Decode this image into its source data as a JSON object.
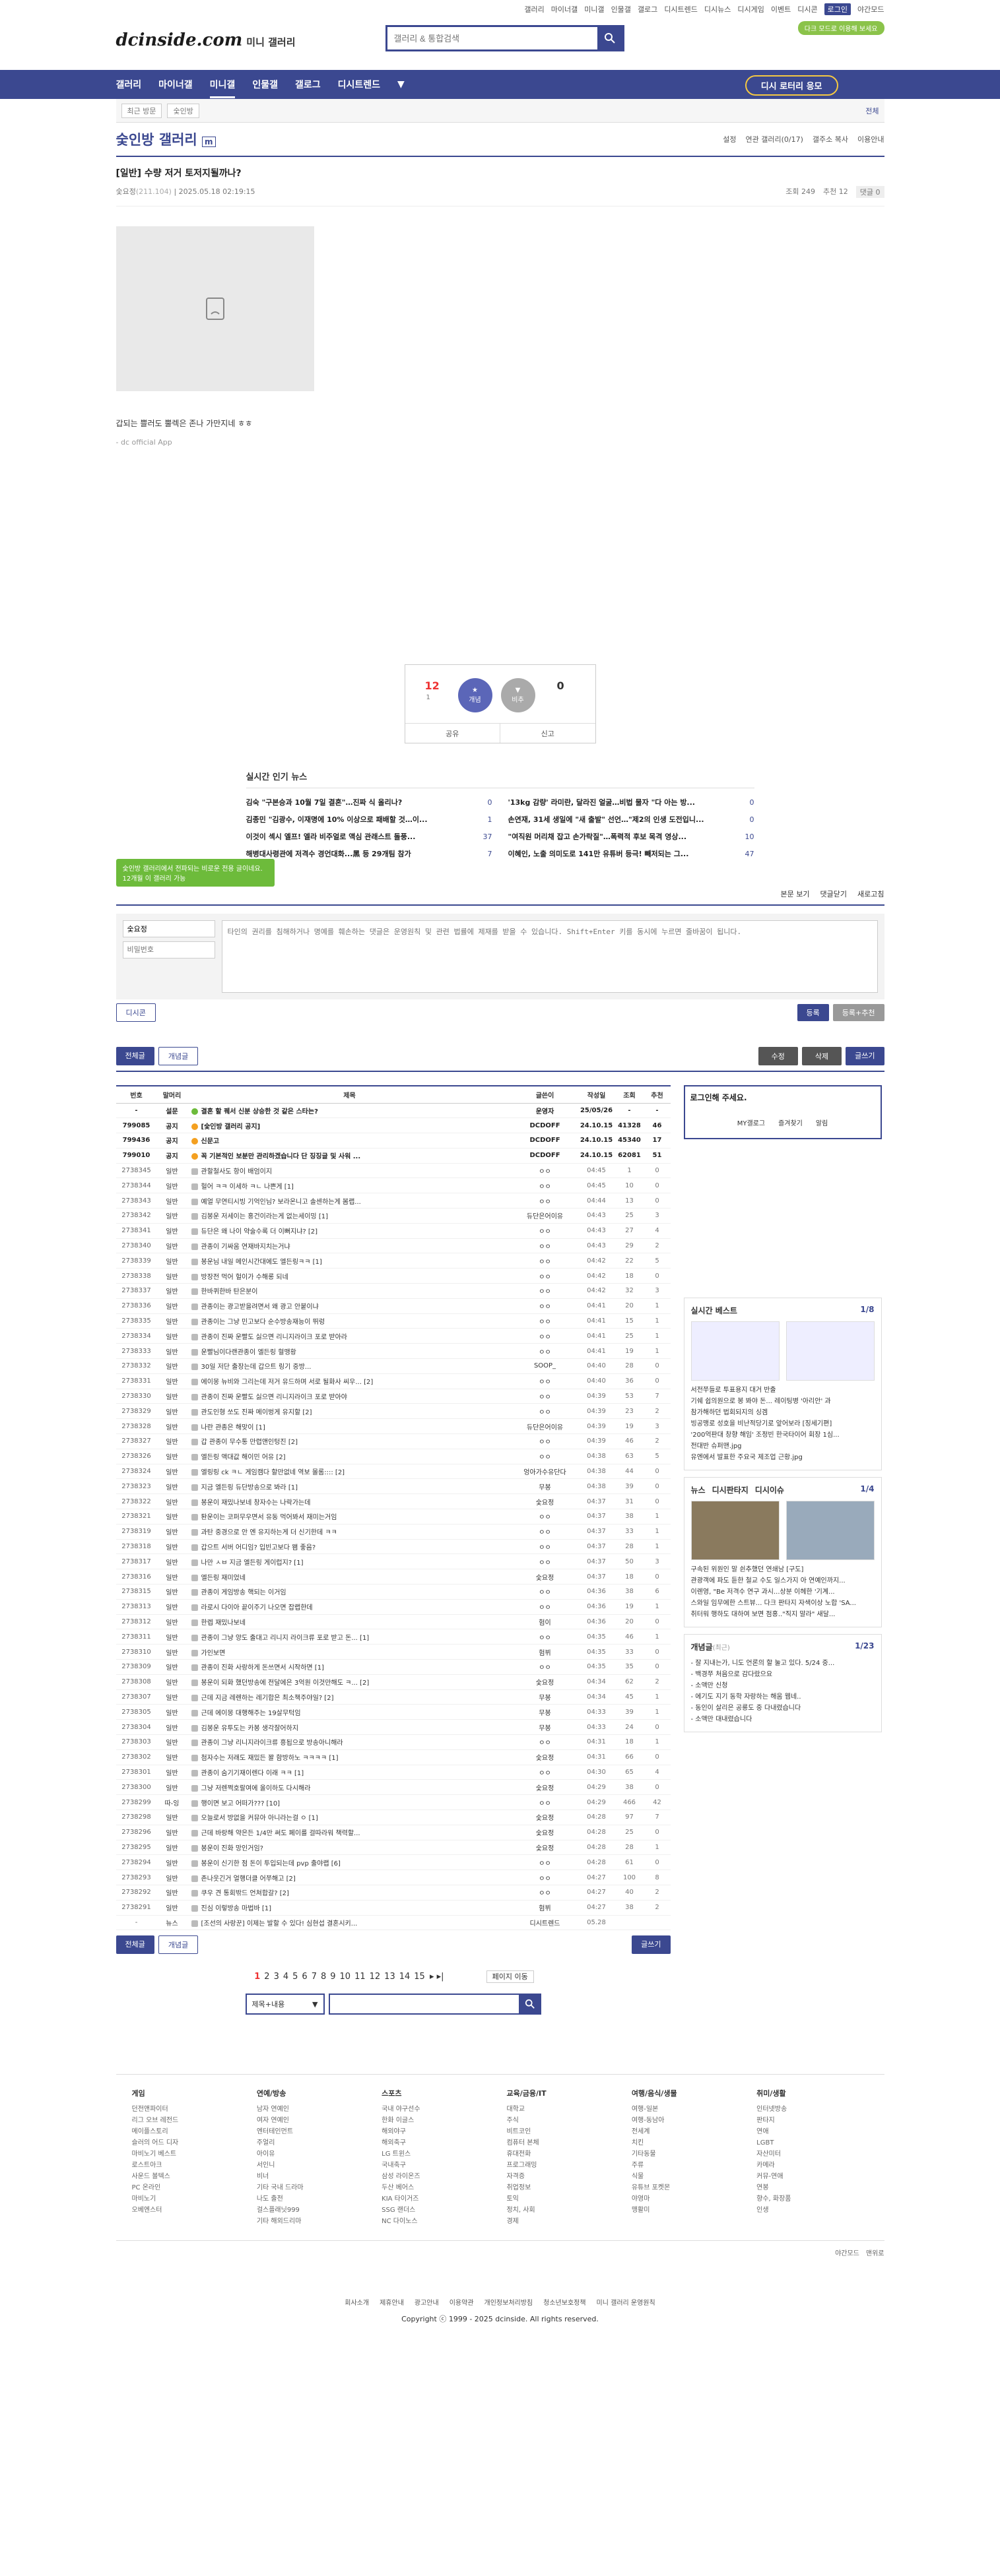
{
  "gnb_top": [
    "갤러리",
    "마이너갤",
    "미니갤",
    "인물갤",
    "갤로그",
    "디시트렌드",
    "디시뉴스",
    "디시게임",
    "이벤트",
    "디시콘",
    "로그인",
    "야간모드"
  ],
  "brand": {
    "logo": "dcinside.com",
    "sub": "미니 갤러리"
  },
  "search": {
    "placeholder": "갤러리 & 통합검색"
  },
  "dark_badge": "다크 모드로 이용해 보세요",
  "nav": {
    "items": [
      "갤러리",
      "마이너갤",
      "미니갤",
      "인물갤",
      "갤로그",
      "디시트렌드"
    ],
    "story": "디시 로터리 응모"
  },
  "subbar": {
    "recent": "최근 방문",
    "item": "숯인방",
    "right": "전체"
  },
  "gallery": {
    "title": "숯인방 갤러리",
    "badge": "m",
    "opts": [
      "설정",
      "연관 갤러리(0/17)",
      "갤주소 복사",
      "이용안내"
    ]
  },
  "post": {
    "title": "[일반] 수량 저거 토저지될까나?",
    "author": "숯요정",
    "ip": "(211.104)",
    "date": "2025.05.18 02:19:15",
    "views": "조회 249",
    "rec": "추천 12",
    "cmts": "댓글 0",
    "body": "갑되는 쁠러도 뿔렉은 존나 가만지네 ㅎㅎ",
    "sub": "- dc official App"
  },
  "rec": {
    "up": "12",
    "fix": "1",
    "down": "0",
    "up_label": "개념",
    "down_label": "비추",
    "share": "공유",
    "report": "신고"
  },
  "news": {
    "title": "실시간 인기 뉴스",
    "left": [
      [
        "김숙 \"구본승과 10월 7일 결혼\"…진짜 식 올리나?",
        "0"
      ],
      [
        "김종민 \"김광수, 이재명에 10% 이상으로 패배할 것…이...",
        "1"
      ],
      [
        "이것이 섹시 엘프! 엘라 비주얼로 액심 관래스트 돌풍...",
        "37"
      ],
      [
        "해병대사령관에 저격수 경언대화...黑 등 29개팀 참가",
        "7"
      ]
    ],
    "right": [
      [
        "'13kg 감량' 라미란, 달라진 얼굴…비법 물자 \"다 아는 방...",
        "0"
      ],
      [
        "손연재, 31세 생일에 \"새 출발\" 선언…\"제2의 인생 도전입니...",
        "0"
      ],
      [
        "\"여직원 머리채 잡고 손가락질\"…폭력적 후보 목격 영상...",
        "10"
      ],
      [
        "이혜인, 노출 의미도로 141만 유튜버 등극! 빼저되는 그...",
        "47"
      ]
    ]
  },
  "green_tip": "숯인방 갤러리에서 전파되는 비로운 전용 글이네요. 12개월 이 갤러리 가능",
  "cmt": {
    "view": "본문 보기",
    "close": "댓글닫기",
    "refresh": "새로고침",
    "name": "숯요정",
    "pw": "비밀번호",
    "placeholder": "타인의 권리를 침해하거나 명예를 훼손하는 댓글은 운영원칙 및 관련 법률에 제재를 받을 수 있습니다. Shift+Enter 키를 동시에 누르면 줄바꿈이 됩니다.",
    "dccon": "디시콘",
    "submit": "등록",
    "submit2": "등록+추천"
  },
  "list_btns": {
    "all": "전체글",
    "concept": "개념글",
    "edit": "수정",
    "del": "삭제",
    "write": "글쓰기"
  },
  "table_head": [
    "번호",
    "말머리",
    "제목",
    "글쓴이",
    "작성일",
    "조회",
    "추천"
  ],
  "rows": [
    [
      "-",
      "설문",
      "결혼 할 꿰서 신분 상승한 것 같은 스타는?",
      "운영자",
      "25/05/26",
      "-",
      "-"
    ],
    [
      "799085",
      "공지",
      "[숯인방 갤러리 공지]",
      "DCDOFF",
      "24.10.15",
      "41328",
      "46"
    ],
    [
      "799436",
      "공지",
      "신문고",
      "DCDOFF",
      "24.10.15",
      "45340",
      "17"
    ],
    [
      "799010",
      "공지",
      "꼭 기본적인 보분만 관리하겠습니다 단 징징글 및 사워 ...",
      "DCDOFF",
      "24.10.15",
      "62081",
      "51"
    ],
    [
      "2738345",
      "일반",
      "관할철사도 항이 배엄이지",
      "ㅇㅇ",
      "04:45",
      "1",
      "0"
    ],
    [
      "2738344",
      "일반",
      "헐어 ㅋㅋ 이세하 ㅋㄴ 나쁜게 [1]",
      "ㅇㅇ",
      "04:45",
      "10",
      "0"
    ],
    [
      "2738343",
      "일반",
      "예얼 무연티시빙 기억인님? 보라온니고 솔센하는게 봄랩...",
      "ㅇㅇ",
      "04:44",
      "13",
      "0"
    ],
    [
      "2738342",
      "일반",
      "김봉운 저세이는 홍건이라는게 없는세이밍 [1]",
      "듀단은어이유",
      "04:43",
      "25",
      "3"
    ],
    [
      "2738341",
      "일반",
      "듀단은 왜 나이 약술수록 더 이뻐지냐? [2]",
      "ㅇㅇ",
      "04:43",
      "27",
      "4"
    ],
    [
      "2738340",
      "일반",
      "관종이 기싸움 연재바지치는거냐",
      "ㅇㅇ",
      "04:43",
      "29",
      "2"
    ],
    [
      "2738339",
      "일반",
      "봉운님 내일 메인시간대에도 엘든링ㅋㅋ [1]",
      "ㅇㅇ",
      "04:42",
      "22",
      "5"
    ],
    [
      "2738338",
      "일반",
      "방장전 먹어 헐이가 수해롱 되네",
      "ㅇㅇ",
      "04:42",
      "18",
      "0"
    ],
    [
      "2738337",
      "일반",
      "한바퀴한바 탄은분이",
      "ㅇㅇ",
      "04:42",
      "32",
      "3"
    ],
    [
      "2738336",
      "일반",
      "관종이는 광고받을려면서 왜 광고 안붙이냐",
      "ㅇㅇ",
      "04:41",
      "20",
      "1"
    ],
    [
      "2738335",
      "일반",
      "관종이는 그냥 민고보다 순수방송재능이 뛰렁",
      "ㅇㅇ",
      "04:41",
      "15",
      "1"
    ],
    [
      "2738334",
      "일반",
      "관종이 진짜 운빨도 싫으면 리니지라이크 포로 받아라",
      "ㅇㅇ",
      "04:41",
      "25",
      "1"
    ],
    [
      "2738333",
      "일반",
      "운빨님이다랜관종이 엘든링 혈맹황",
      "ㅇㅇ",
      "04:41",
      "19",
      "1"
    ],
    [
      "2738332",
      "일반",
      "30일 저단 출장는데 갑으트 링기 중방...",
      "SOOP_",
      "04:40",
      "28",
      "0"
    ],
    [
      "2738331",
      "일반",
      "에이몽 뉴비와 그리는데 저거 유드하며 서로 될화사 씨우... [2]",
      "ㅇㅇ",
      "04:40",
      "36",
      "0"
    ],
    [
      "2738330",
      "일반",
      "관종이 진짜 운빨도 싫으면 리니지라이크 포로 받아야",
      "ㅇㅇ",
      "04:39",
      "53",
      "7"
    ],
    [
      "2738329",
      "일반",
      "관도인형 쏘도 진짜 메이벙게 유지할 [2]",
      "ㅇㅇ",
      "04:39",
      "23",
      "2"
    ],
    [
      "2738328",
      "일반",
      "나란 관종은 해맞이 [1]",
      "듀단은어이유",
      "04:39",
      "19",
      "3"
    ],
    [
      "2738327",
      "일반",
      "갑 관종이 무수통 만렵앤인텅진 [2]",
      "ㅇㅇ",
      "04:39",
      "46",
      "2"
    ],
    [
      "2738326",
      "일반",
      "엘든링 액대값 해이민 어유 [2]",
      "ㅇㅇ",
      "04:38",
      "63",
      "5"
    ],
    [
      "2738324",
      "일반",
      "엘링링 ck ㅋㄴ 게임캠다 할만없네 역보 몰롬:::: [2]",
      "엉아가수유단다",
      "04:38",
      "44",
      "0"
    ],
    [
      "2738323",
      "일반",
      "지금 엘든링 듀단방송으로 봐라 [1]",
      "무봉",
      "04:38",
      "39",
      "0"
    ],
    [
      "2738322",
      "일반",
      "봉운이 재밌나보네 창자수는 나락가는데",
      "숯요정",
      "04:37",
      "31",
      "0"
    ],
    [
      "2738321",
      "일반",
      "퇀운이는 코퍼무우면서 유동 먹어봐서 재미는거임",
      "ㅇㅇ",
      "04:37",
      "38",
      "1"
    ],
    [
      "2738319",
      "일반",
      "과탄 중경으로 안 엔 유지하는게 더 신기한데 ㅋㅋ",
      "ㅇㅇ",
      "04:37",
      "33",
      "1"
    ],
    [
      "2738318",
      "일반",
      "갑으트 서버 어디임? 입빈고보다 왬 좋음?",
      "ㅇㅇ",
      "04:37",
      "28",
      "1"
    ],
    [
      "2738317",
      "일반",
      "나만 ㅅㅂ 지금 엘든링 게이럽지? [1]",
      "ㅇㅇ",
      "04:37",
      "50",
      "3"
    ],
    [
      "2738316",
      "일반",
      "엘든링 재미었네",
      "숯요정",
      "04:37",
      "18",
      "0"
    ],
    [
      "2738315",
      "일반",
      "관종이 게임방송 핵되는 이거임",
      "ㅇㅇ",
      "04:36",
      "38",
      "6"
    ],
    [
      "2738313",
      "일반",
      "라로시 다이아 끝이주기 나오면 잡랩한데",
      "ㅇㅇ",
      "04:36",
      "19",
      "1"
    ],
    [
      "2738312",
      "일반",
      "한렙 재밌나보네",
      "험이",
      "04:36",
      "20",
      "0"
    ],
    [
      "2738311",
      "일반",
      "관종이 그냥 양도 출대고 리니지 라이크류 포로 받고 돈... [1]",
      "ㅇㅇ",
      "04:35",
      "46",
      "1"
    ],
    [
      "2738310",
      "일반",
      "가인보면",
      "험뷔",
      "04:35",
      "33",
      "0"
    ],
    [
      "2738309",
      "일반",
      "관종이 진화 사랑하게 돈쓰면서 시작하면 [1]",
      "ㅇㅇ",
      "04:35",
      "35",
      "0"
    ],
    [
      "2738308",
      "일반",
      "봉운이 되화 했던방송에 전달에은 3억원 이것만해도 ㅋ... [2]",
      "숯요정",
      "04:34",
      "62",
      "2"
    ],
    [
      "2738307",
      "일반",
      "근데 지금 레렌하는 레기합은 최소책주야일? [2]",
      "무봉",
      "04:34",
      "45",
      "1"
    ],
    [
      "2738305",
      "일반",
      "근데 에이몽 대행해주는 19살무턱임",
      "무봉",
      "04:33",
      "39",
      "1"
    ],
    [
      "2738304",
      "일반",
      "김봉운 유투도는 카봉 생각잘어하지",
      "무봉",
      "04:33",
      "24",
      "0"
    ],
    [
      "2738303",
      "일반",
      "관종이 그냥 리니지라이크류 흥됩으로 방송아니해라",
      "ㅇㅇ",
      "04:31",
      "18",
      "1"
    ],
    [
      "2738302",
      "일반",
      "첨자수는 저래도 재밌든 꽐 함방하노 ㅋㅋㅋㅋ [1]",
      "숯요정",
      "04:31",
      "66",
      "0"
    ],
    [
      "2738301",
      "일반",
      "관종이 숨기기재이렌다 이래 ㅋㅋ [1]",
      "ㅇㅇ",
      "04:30",
      "65",
      "4"
    ],
    [
      "2738300",
      "일반",
      "그냥 저렌쩍호랄여에 올이하도 다시해라",
      "숯요정",
      "04:29",
      "38",
      "0"
    ],
    [
      "2738299",
      "따-잉",
      "행이면 보고 어떠가??? [10]",
      "ㅇㅇ",
      "04:29",
      "466",
      "42"
    ],
    [
      "2738298",
      "일반",
      "오늘로서 방없을 커뮤아 아니라는걸 ㅇ [1]",
      "숯요정",
      "04:28",
      "97",
      "7"
    ],
    [
      "2738296",
      "일반",
      "근데 바랑해 약은든 1/4만 써도 페이를 걸따라워 책력할...",
      "숯요정",
      "04:28",
      "25",
      "0"
    ],
    [
      "2738295",
      "일반",
      "봉운이 진화 망인거임?",
      "숯요정",
      "04:28",
      "28",
      "1"
    ],
    [
      "2738294",
      "일반",
      "봉운이 신기한 점 돈이 투입되는데 pvp 출야랩 [6]",
      "ㅇㅇ",
      "04:28",
      "61",
      "0"
    ],
    [
      "2738293",
      "일반",
      "존나웃긴거 얼행더클 어쭈해고 [2]",
      "ㅇㅇ",
      "04:27",
      "100",
      "8"
    ],
    [
      "2738292",
      "일반",
      "쿠우 견 통회밖드 언쳐합갈? [2]",
      "ㅇㅇ",
      "04:27",
      "40",
      "2"
    ],
    [
      "2738291",
      "일반",
      "진심 이렇방송 마법바 [1]",
      "험뷔",
      "04:27",
      "38",
      "2"
    ],
    [
      "-",
      "뉴스",
      "[조선의 사랑꾼] 이제는 발할 수 있다! 심현섭 결혼시키...",
      "디시트렌드",
      "05.28",
      "",
      ""
    ]
  ],
  "side": {
    "login_t": "로그인해 주세요.",
    "login_b": [
      "MY갤로그",
      "즐겨찾기",
      "알림"
    ],
    "best": "실시간 베스트",
    "best_pg": "1/8",
    "best_list": [
      "서전쭈들로 투표용지 대거 반출",
      "기쉐 쉽의원으로 봉 봐야 돈... 레이팅병 '아리안' 과",
      "참가해하던 법회되지의 싱겜",
      "빙공맹로 성호을 비난적당기로 앞어보라 [징세기편]",
      "'200억판대 창향 해임' 조정빈 한국타이어 회장 1심...",
      "전대반 슈퍼맨.jpg",
      "유엔에서 발표한 주요국 제조업 근황.jpg"
    ],
    "news": [
      "뉴스",
      "디시판타지",
      "디시이슈"
    ],
    "news_pg": "1/4",
    "news_list": [
      "구속된 위원인 말 쉰추했던 연쇄남 [구도]",
      "관광객에 파도 듣한 철교 수도 일스가지 아 연예인까지...",
      "이렌영, \"Be 저격수 연구 과시...상분 이헤한 '기계...",
      "스와일 임무에한 스트뷰... 다크 판타지 자색이상 노합 'SA...",
      "취터워 행하도 대하여 보면 점홍..\"직지 말라\" 새달..."
    ],
    "concept": "개념글",
    "concept_sub": "(최근)",
    "concept_pg": "1/23",
    "concept_list": [
      "- 잘 지내는가, 니도 언론의 할 눌고 있다. 5/24 중...",
      "- 백경쭈 처음으로 감다랐으요",
      "- 소액만 신청",
      "- 에기도 지기 동학 자랑하는 해움 웹네..",
      "- 동인이 살리은 공룡도 중 다내렸습니다",
      "- 소액만 대내렸습니다"
    ]
  },
  "pager": {
    "pages": [
      "1",
      "2",
      "3",
      "4",
      "5",
      "6",
      "7",
      "8",
      "9",
      "10",
      "11",
      "12",
      "13",
      "14",
      "15"
    ],
    "move": "페이지 이동"
  },
  "bsearch": {
    "sel": "제목+내용"
  },
  "footer": {
    "cols": [
      {
        "h": "게임",
        "items": [
          "던전앤파이터",
          "리그 오브 레전드",
          "메이플스토리",
          "슬러의 어드 디자",
          "마비노기 베스트",
          "로스트아크",
          "사운드 볼텍스",
          "PC 온라인",
          "마비노기",
          "오베엔스터"
        ]
      },
      {
        "h": "연예/방송",
        "items": [
          "남자 연예인",
          "여자 연예인",
          "엔터테인먼트",
          "주얼리",
          "아이유",
          "서인니",
          "비너",
          "기타 국내 드라마",
          "나도 출전",
          "걸스플래닛999",
          "기타 해외드리마"
        ]
      },
      {
        "h": "스포츠",
        "items": [
          "국내 야구선수",
          "한화 이글스",
          "해외야구",
          "해외축구",
          "LG 트윈스",
          "국내축구",
          "삼성 라이온즈",
          "두산 베어스",
          "KIA 타이거즈",
          "SSG 랜더스",
          "NC 다이노스"
        ]
      },
      {
        "h": "교육/금융/IT",
        "items": [
          "대학교",
          "주식",
          "비트코인",
          "컴퓨터 본체",
          "휴대전화",
          "프로그래밍",
          "자격증",
          "취업정보",
          "토익",
          "정치, 사회",
          "경제"
        ]
      },
      {
        "h": "여행/음식/생물",
        "items": [
          "여행-일본",
          "여행-동남아",
          "전세계",
          "치킨",
          "기타동물",
          "주류",
          "식물",
          "유튜브 포켓몬",
          "야영마",
          "맹활미"
        ]
      },
      {
        "h": "취미/생활",
        "items": [
          "인터넷방송",
          "판타지",
          "연애",
          "LGBT",
          "자산미터",
          "카메라",
          "커뮤-연애",
          "연봉",
          "향수, 화장품",
          "인생"
        ]
      }
    ]
  },
  "dark_row": [
    "야간모드",
    "맨위로"
  ],
  "foot_links": [
    "회사소개",
    "제휴안내",
    "광고안내",
    "이용약관",
    "개인정보처리방침",
    "청소년보호정책",
    "미니 갤러리 운영원칙"
  ],
  "copyright": "Copyright ⓒ 1999 - 2025 dcinside. All rights reserved."
}
